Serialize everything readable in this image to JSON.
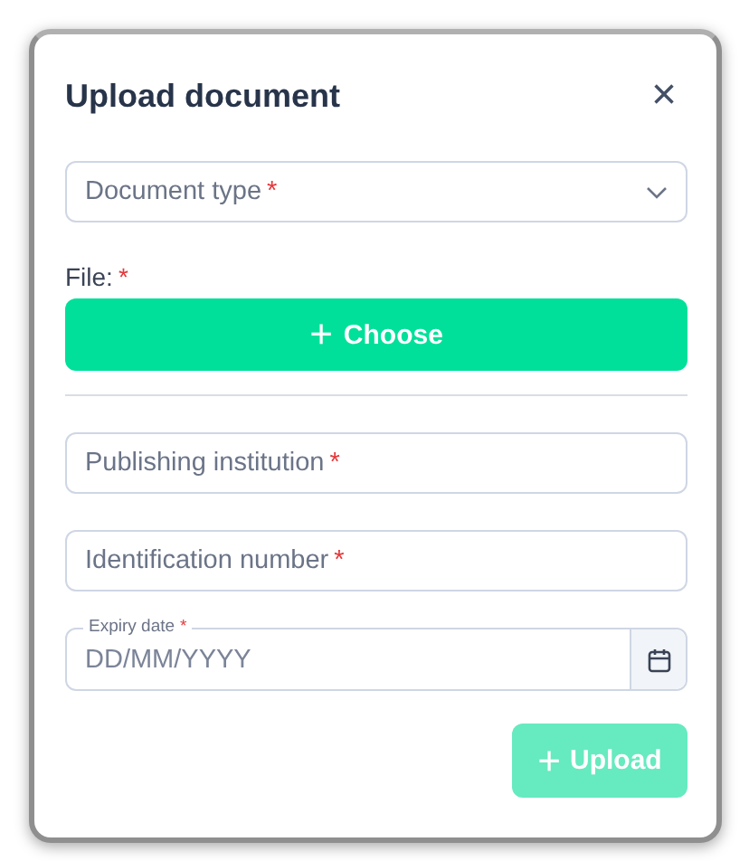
{
  "dialog": {
    "title": "Upload document",
    "close": "×"
  },
  "document_type": {
    "placeholder": "Document type",
    "required_mark": "*"
  },
  "file": {
    "label": "File:",
    "required_mark": "*",
    "button": {
      "icon": "+",
      "label": "Choose"
    }
  },
  "fields": [
    {
      "kind": "text",
      "placeholder": "Publishing institution",
      "required_mark": "*"
    },
    {
      "kind": "text",
      "placeholder": "Identification number",
      "required_mark": "*"
    },
    {
      "kind": "date",
      "label": "Expiry date",
      "required_mark": "*",
      "placeholder": "DD/MM/YYYY"
    }
  ],
  "submit": {
    "icon": "+",
    "label": "Upload",
    "disabled": true
  }
}
